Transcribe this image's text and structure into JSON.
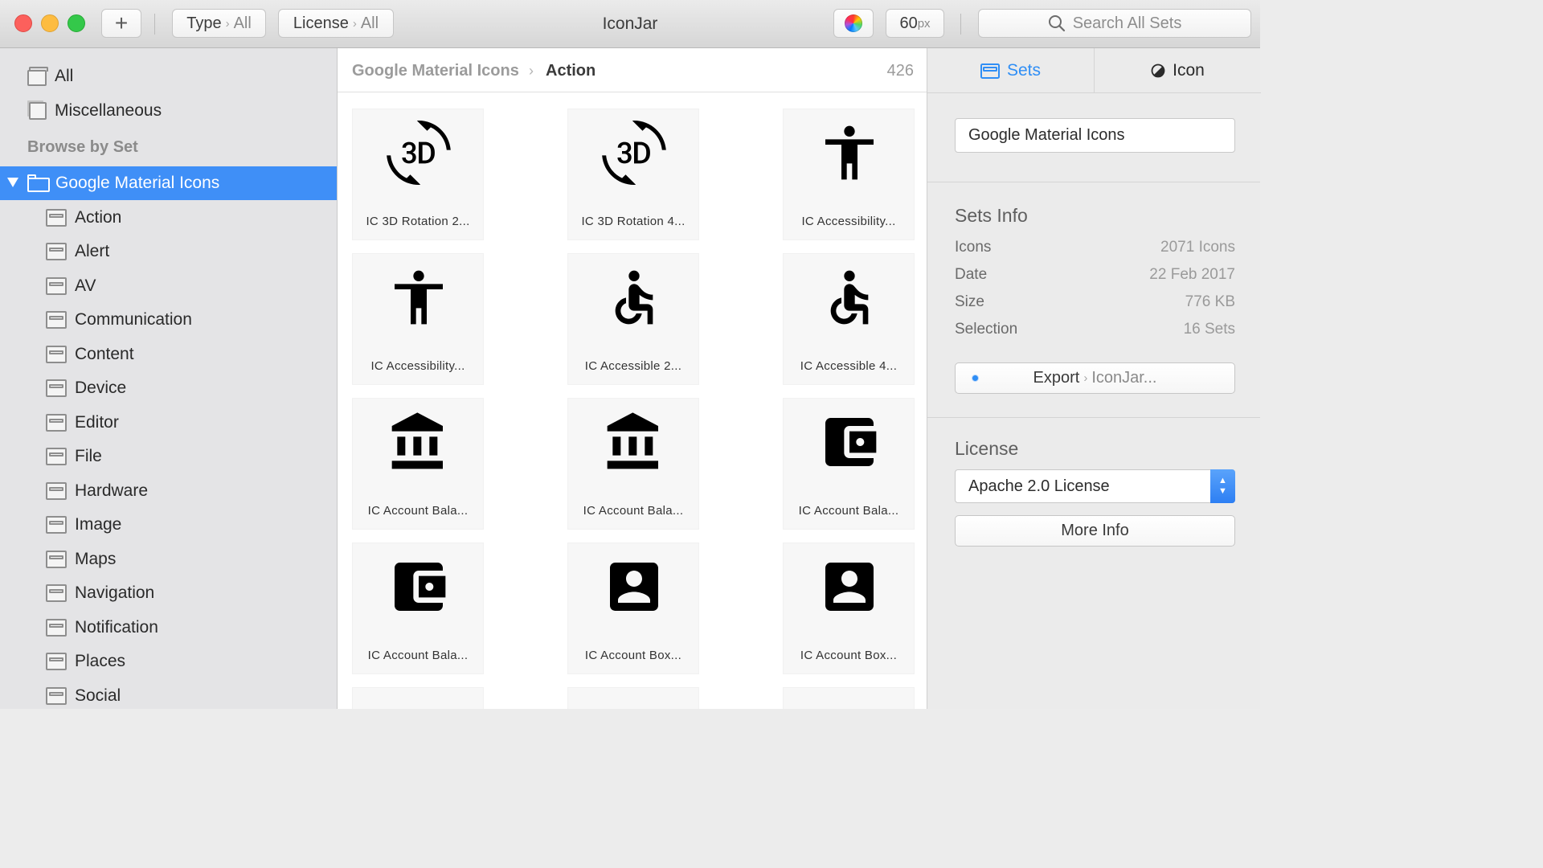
{
  "app": {
    "title": "IconJar"
  },
  "toolbar": {
    "add_label": "+",
    "type_filter": {
      "label": "Type",
      "value": "All"
    },
    "license_filter": {
      "label": "License",
      "value": "All"
    },
    "size_value": "60",
    "size_unit": "px",
    "search_placeholder": "Search All Sets"
  },
  "sidebar": {
    "top_items": [
      {
        "label": "All",
        "icon": "stack-icon"
      },
      {
        "label": "Miscellaneous",
        "icon": "square-icon"
      }
    ],
    "section_heading": "Browse by Set",
    "selected_set": "Google Material Icons",
    "groups": [
      "Action",
      "Alert",
      "AV",
      "Communication",
      "Content",
      "Device",
      "Editor",
      "File",
      "Hardware",
      "Image",
      "Maps",
      "Navigation",
      "Notification",
      "Places",
      "Social"
    ]
  },
  "main": {
    "breadcrumb_root": "Google Material Icons",
    "breadcrumb_sep": "›",
    "breadcrumb_current": "Action",
    "count": "426",
    "icons": [
      {
        "caption": "IC 3D Rotation 2...",
        "icon": "3d-rotation-icon"
      },
      {
        "caption": "IC 3D Rotation 4...",
        "icon": "3d-rotation-icon"
      },
      {
        "caption": "IC Accessibility...",
        "icon": "accessibility-icon"
      },
      {
        "caption": "IC Accessibility...",
        "icon": "accessibility-icon"
      },
      {
        "caption": "IC Accessible 2...",
        "icon": "accessible-icon"
      },
      {
        "caption": "IC Accessible 4...",
        "icon": "accessible-icon"
      },
      {
        "caption": "IC Account Bala...",
        "icon": "account-balance-icon"
      },
      {
        "caption": "IC Account Bala...",
        "icon": "account-balance-icon"
      },
      {
        "caption": "IC Account Bala...",
        "icon": "account-balance-wallet-icon"
      },
      {
        "caption": "IC Account Bala...",
        "icon": "account-balance-wallet-icon"
      },
      {
        "caption": "IC Account Box...",
        "icon": "account-box-icon"
      },
      {
        "caption": "IC Account Box...",
        "icon": "account-box-icon"
      }
    ]
  },
  "right_panel": {
    "tab_sets": "Sets",
    "tab_icon": "Icon",
    "set_name": "Google Material Icons",
    "info_heading": "Sets Info",
    "info": [
      {
        "label": "Icons",
        "value": "2071 Icons"
      },
      {
        "label": "Date",
        "value": "22 Feb 2017"
      },
      {
        "label": "Size",
        "value": "776 KB"
      },
      {
        "label": "Selection",
        "value": "16 Sets"
      }
    ],
    "export_label": "Export",
    "export_target": "IconJar...",
    "license_heading": "License",
    "license_value": "Apache 2.0 License",
    "more_info_label": "More Info"
  },
  "colors": {
    "accent": "#3f8ff7",
    "tab_active": "#2f8ef5"
  }
}
